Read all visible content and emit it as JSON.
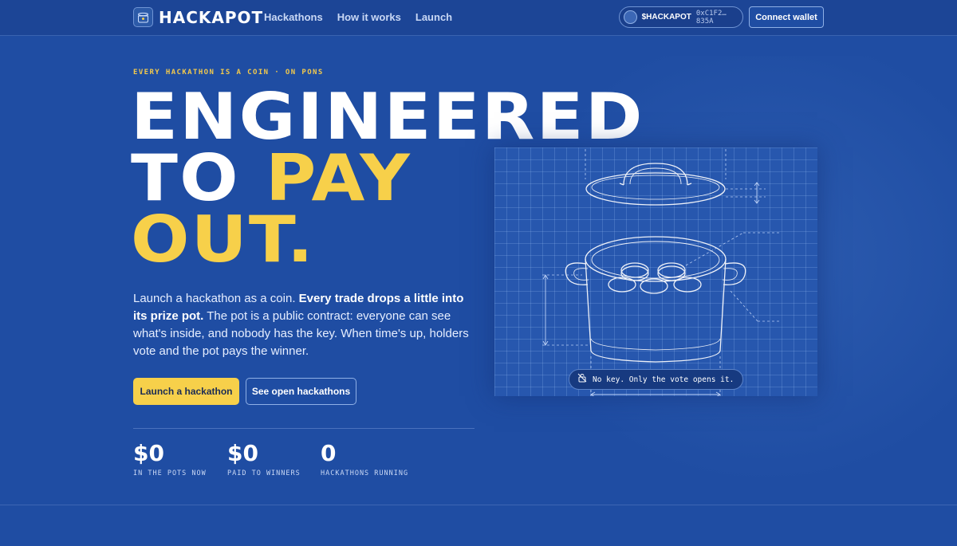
{
  "nav": {
    "brand": "HACKAPOT",
    "links": [
      "Hackathons",
      "How it works",
      "Launch"
    ],
    "token": {
      "name": "$HACKAPOT",
      "address": "0xC1F2…835A"
    },
    "connect_label": "Connect wallet"
  },
  "hero": {
    "eyebrow": "EVERY HACKATHON IS A COIN · ON PONS",
    "headline_line1": "ENGINEERED",
    "headline_to": "TO ",
    "headline_pay": "PAY",
    "headline_out": "OUT.",
    "lede_1": "Launch a hackathon as a coin. ",
    "lede_bold": "Every trade drops a little into its prize pot.",
    "lede_2": " The pot is a public contract: everyone can see what's inside, and nobody has the key. When time's up, holders vote and the pot pays the winner.",
    "primary_cta": "Launch a hackathon",
    "secondary_cta": "See open hackathons"
  },
  "stats": [
    {
      "value": "$0",
      "label": "IN THE POTS NOW"
    },
    {
      "value": "$0",
      "label": "PAID TO WINNERS"
    },
    {
      "value": "0",
      "label": "HACKATHONS RUNNING"
    }
  ],
  "illustration": {
    "caption": "No key. Only the vote opens it.",
    "caption_icon": "lock-off-icon",
    "subject": "pot-blueprint"
  },
  "colors": {
    "background": "#1f4da3",
    "accent_yellow": "#f7d04a",
    "eyebrow_yellow": "#f2c94c"
  }
}
